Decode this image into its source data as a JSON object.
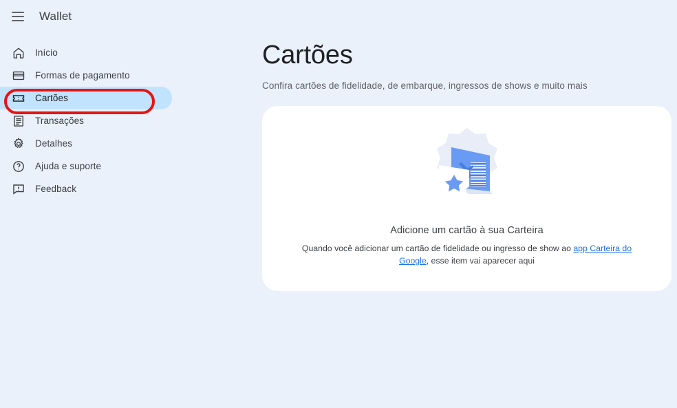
{
  "colors": {
    "page_background": "#eaf1fb",
    "card_background": "#ffffff",
    "selected_item_background": "#c2e3fd",
    "annotation_ring": "#e81313",
    "link": "#1a73e8",
    "text_primary": "#3c4043",
    "text_secondary": "#5f6368",
    "illustration_primary": "#5b8def",
    "illustration_light": "#e8edf8"
  },
  "topbar": {
    "menu_icon": "hamburger-menu-icon",
    "title": "Wallet"
  },
  "sidebar": {
    "items": [
      {
        "label": "Início",
        "icon": "home-icon",
        "selected": false
      },
      {
        "label": "Formas de pagamento",
        "icon": "credit-card-icon",
        "selected": false
      },
      {
        "label": "Cartões",
        "icon": "ticket-icon",
        "selected": true
      },
      {
        "label": "Transações",
        "icon": "receipt-icon",
        "selected": false
      },
      {
        "label": "Detalhes",
        "icon": "gear-icon",
        "selected": false
      },
      {
        "label": "Ajuda e suporte",
        "icon": "help-circle-icon",
        "selected": false
      },
      {
        "label": "Feedback",
        "icon": "feedback-icon",
        "selected": false
      }
    ]
  },
  "main": {
    "title": "Cartões",
    "subtitle": "Confira cartões de fidelidade, de embarque, ingressos de shows e muito mais",
    "empty_state": {
      "illustration": "boarding-pass-and-ticket-illustration",
      "title": "Adicione um cartão à sua Carteira",
      "description_before_link": "Quando você adicionar um cartão de fidelidade ou ingresso de show ao ",
      "link_text": "app Carteira do Google",
      "description_after_link": ", esse item vai aparecer aqui"
    }
  }
}
